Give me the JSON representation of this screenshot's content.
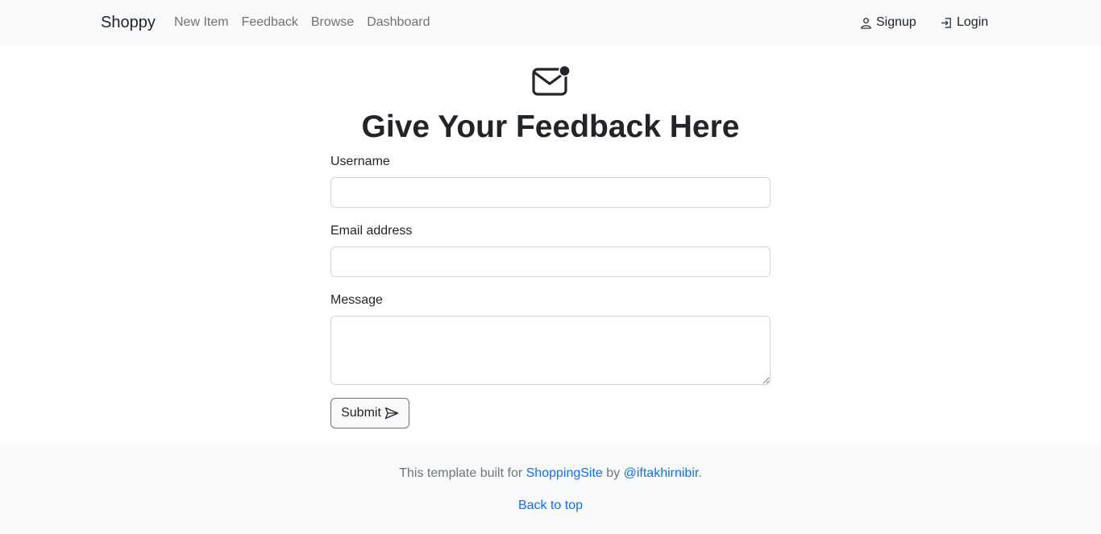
{
  "navbar": {
    "brand": "Shoppy",
    "links": [
      "New Item",
      "Feedback",
      "Browse",
      "Dashboard"
    ],
    "signup": {
      "label": "Signup",
      "icon": "person-icon"
    },
    "login": {
      "label": "Login",
      "icon": "login-icon"
    }
  },
  "hero": {
    "icon": "envelope-icon",
    "title": "Give Your Feedback Here"
  },
  "form": {
    "username_label": "Username",
    "username_value": "",
    "email_label": "Email address",
    "email_value": "",
    "message_label": "Message",
    "message_value": "",
    "submit_label": "Submit",
    "submit_icon": "send-icon"
  },
  "footer": {
    "text_before": "This template built for ",
    "site_link": "ShoppingSite",
    "text_middle": " by ",
    "author_link": "@iftakhirnibir",
    "text_end": ".",
    "back_to_top": "Back to top"
  },
  "colors": {
    "navbar_bg": "#f8f9fa",
    "link": "#0d6efd",
    "muted": "#6c757d"
  }
}
